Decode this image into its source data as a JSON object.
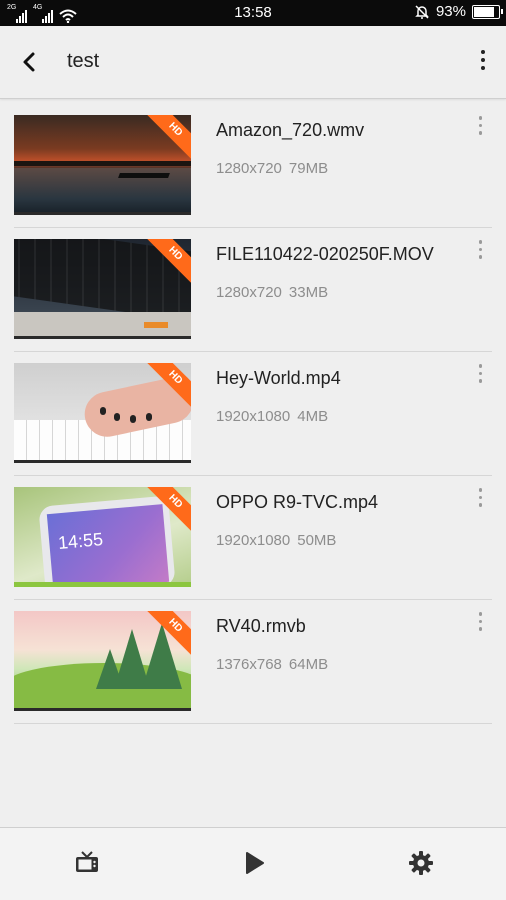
{
  "status_bar": {
    "signal1_tag": "2G",
    "signal2_tag": "4G",
    "time": "13:58",
    "battery_text": "93%",
    "battery_level": 0.93
  },
  "app_bar": {
    "title": "test"
  },
  "videos": [
    {
      "name": "Amazon_720.wmv",
      "resolution": "1280x720",
      "size": "79MB",
      "badge": "HD"
    },
    {
      "name": "FILE110422-020250F.MOV",
      "resolution": "1280x720",
      "size": "33MB",
      "badge": "HD"
    },
    {
      "name": "Hey-World.mp4",
      "resolution": "1920x1080",
      "size": "4MB",
      "badge": "HD"
    },
    {
      "name": "OPPO R9-TVC.mp4",
      "resolution": "1920x1080",
      "size": "50MB",
      "badge": "HD",
      "thumb_text": "14:55"
    },
    {
      "name": "RV40.rmvb",
      "resolution": "1376x768",
      "size": "64MB",
      "badge": "HD"
    }
  ],
  "bottom_nav": {
    "items": [
      {
        "icon": "tv-icon"
      },
      {
        "icon": "play-icon"
      },
      {
        "icon": "settings-gear-icon"
      }
    ]
  },
  "colors": {
    "hd_badge": "#ff6a1a",
    "background": "#efefef"
  }
}
